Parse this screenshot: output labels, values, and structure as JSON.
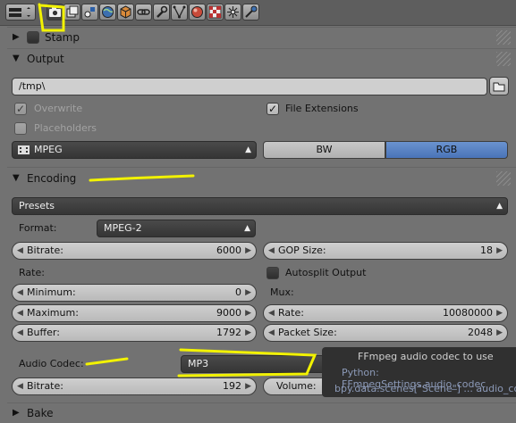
{
  "header": {
    "editor_menu_icon": "properties-editor-icon",
    "tabs": [
      {
        "icon": "render-camera-icon",
        "active": true
      },
      {
        "icon": "render-layers-icon"
      },
      {
        "icon": "scene-icon"
      },
      {
        "icon": "world-icon"
      },
      {
        "icon": "object-icon"
      },
      {
        "icon": "constraints-icon"
      },
      {
        "icon": "modifiers-wrench-icon"
      },
      {
        "icon": "object-data-icon"
      },
      {
        "icon": "material-icon"
      },
      {
        "icon": "texture-icon"
      },
      {
        "icon": "particles-icon"
      },
      {
        "icon": "physics-icon"
      }
    ]
  },
  "stamp": {
    "title": "Stamp"
  },
  "output": {
    "title": "Output",
    "path": "/tmp\\",
    "overwrite_label": "Overwrite",
    "overwrite_checked": true,
    "file_extensions_label": "File Extensions",
    "file_extensions_checked": true,
    "placeholders_label": "Placeholders",
    "placeholders_checked": false,
    "file_format": "MPEG",
    "color_bw": "BW",
    "color_rgb": "RGB",
    "color_selected": "RGB"
  },
  "encoding": {
    "title": "Encoding",
    "presets": "Presets",
    "format_label": "Format:",
    "format_value": "MPEG-2",
    "bitrate_label": "Bitrate:",
    "bitrate_value": "6000",
    "gop_label": "GOP Size:",
    "gop_value": "18",
    "rate_label": "Rate:",
    "autosplit_label": "Autosplit Output",
    "autosplit_checked": false,
    "minimum_label": "Minimum:",
    "minimum_value": "0",
    "mux_label": "Mux:",
    "maximum_label": "Maximum:",
    "maximum_value": "9000",
    "mux_rate_label": "Rate:",
    "mux_rate_value": "10080000",
    "buffer_label": "Buffer:",
    "buffer_value": "1792",
    "packet_label": "Packet Size:",
    "packet_value": "2048",
    "audio_codec_label": "Audio Codec:",
    "audio_codec_value": "MP3",
    "audio_bitrate_label": "Bitrate:",
    "audio_bitrate_value": "192",
    "volume_label": "Volume:"
  },
  "bake": {
    "title": "Bake"
  },
  "tooltip": {
    "line1": "FFmpeg audio codec to use",
    "line2": "Python: FFmpegSettings.audio_codec",
    "line3": "bpy.data.scenes[\"Scene\"] ... audio_codec"
  },
  "colors": {
    "background": "#727272",
    "accent_blue": "#5680c2",
    "annotation_yellow": "#f2f200",
    "tooltip_bg": "#303030"
  }
}
